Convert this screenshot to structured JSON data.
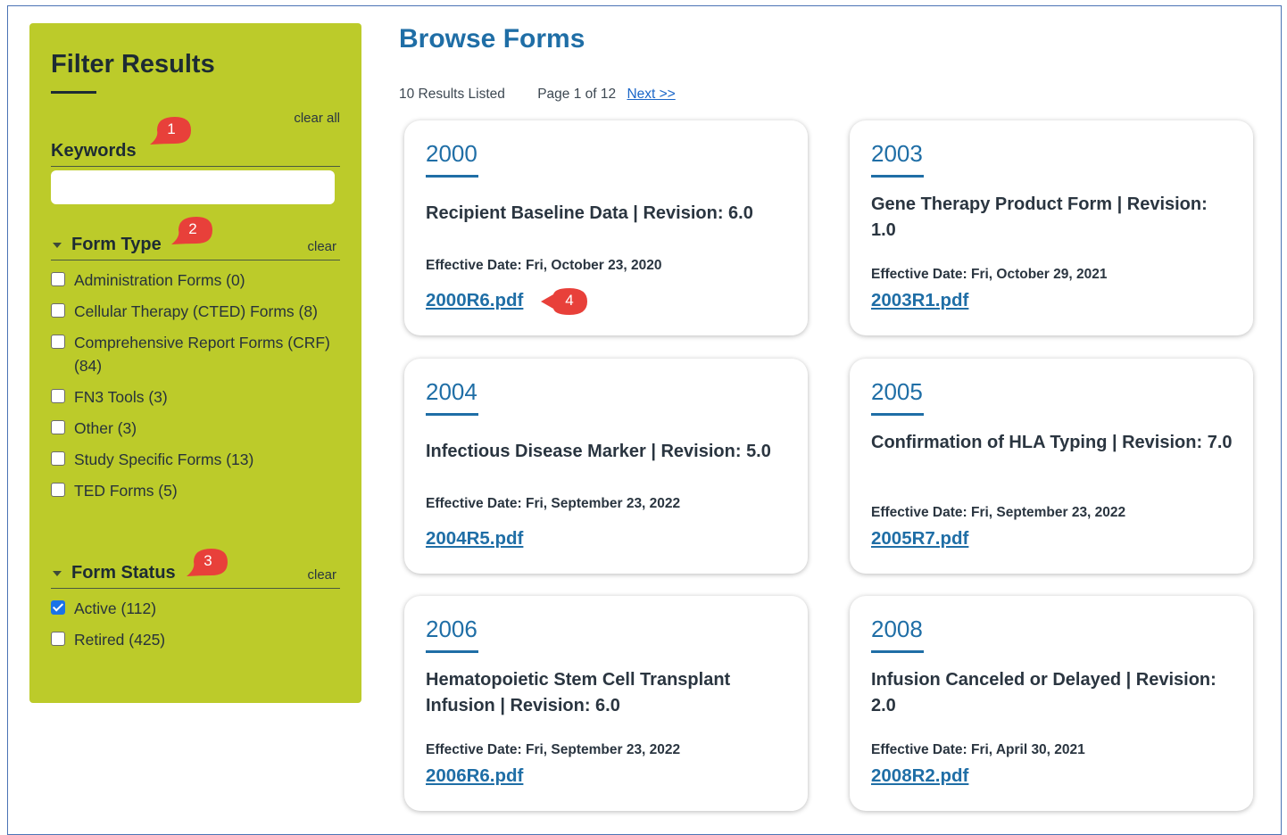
{
  "sidebar": {
    "title": "Filter Results",
    "clear_all": "clear all",
    "keywords": {
      "label": "Keywords",
      "value": "",
      "placeholder": ""
    },
    "form_type": {
      "label": "Form Type",
      "clear": "clear",
      "options": [
        {
          "label": "Administration Forms (0)",
          "checked": false
        },
        {
          "label": "Cellular Therapy (CTED) Forms (8)",
          "checked": false
        },
        {
          "label": "Comprehensive Report Forms (CRF) (84)",
          "checked": false
        },
        {
          "label": "FN3 Tools (3)",
          "checked": false
        },
        {
          "label": "Other (3)",
          "checked": false
        },
        {
          "label": "Study Specific Forms (13)",
          "checked": false
        },
        {
          "label": "TED Forms (5)",
          "checked": false
        }
      ]
    },
    "form_status": {
      "label": "Form Status",
      "clear": "clear",
      "options": [
        {
          "label": "Active (112)",
          "checked": true
        },
        {
          "label": "Retired (425)",
          "checked": false
        }
      ]
    }
  },
  "callouts": [
    "1",
    "2",
    "3",
    "4"
  ],
  "main": {
    "title": "Browse Forms",
    "results_count": "10 Results Listed",
    "page_info": "Page 1 of 12",
    "next_label": "Next >>",
    "cards": [
      {
        "number": "2000",
        "description": "Recipient Baseline Data  |  Revision: 6.0",
        "effective": "Effective Date: Fri, October 23, 2020",
        "pdf": "2000R6.pdf"
      },
      {
        "number": "2003",
        "description": "Gene Therapy Product Form  |  Revision: 1.0",
        "effective": "Effective Date: Fri, October 29, 2021",
        "pdf": "2003R1.pdf"
      },
      {
        "number": "2004",
        "description": "Infectious Disease Marker  |  Revision: 5.0",
        "effective": "Effective Date: Fri, September 23, 2022",
        "pdf": "2004R5.pdf"
      },
      {
        "number": "2005",
        "description": "Confirmation of HLA Typing  |  Revision: 7.0",
        "effective": "Effective Date: Fri, September 23, 2022",
        "pdf": "2005R7.pdf"
      },
      {
        "number": "2006",
        "description": "Hematopoietic Stem Cell Transplant Infusion  |  Revision: 6.0",
        "effective": "Effective Date: Fri, September 23, 2022",
        "pdf": "2006R6.pdf"
      },
      {
        "number": "2008",
        "description": "Infusion Canceled or Delayed  |  Revision: 2.0",
        "effective": "Effective Date: Fri, April 30, 2021",
        "pdf": "2008R2.pdf"
      }
    ]
  },
  "colors": {
    "sidebar_bg": "#bccb2a",
    "accent_blue": "#1f6ea6",
    "callout_red": "#e8403a",
    "frame_border": "#4b73b5"
  }
}
